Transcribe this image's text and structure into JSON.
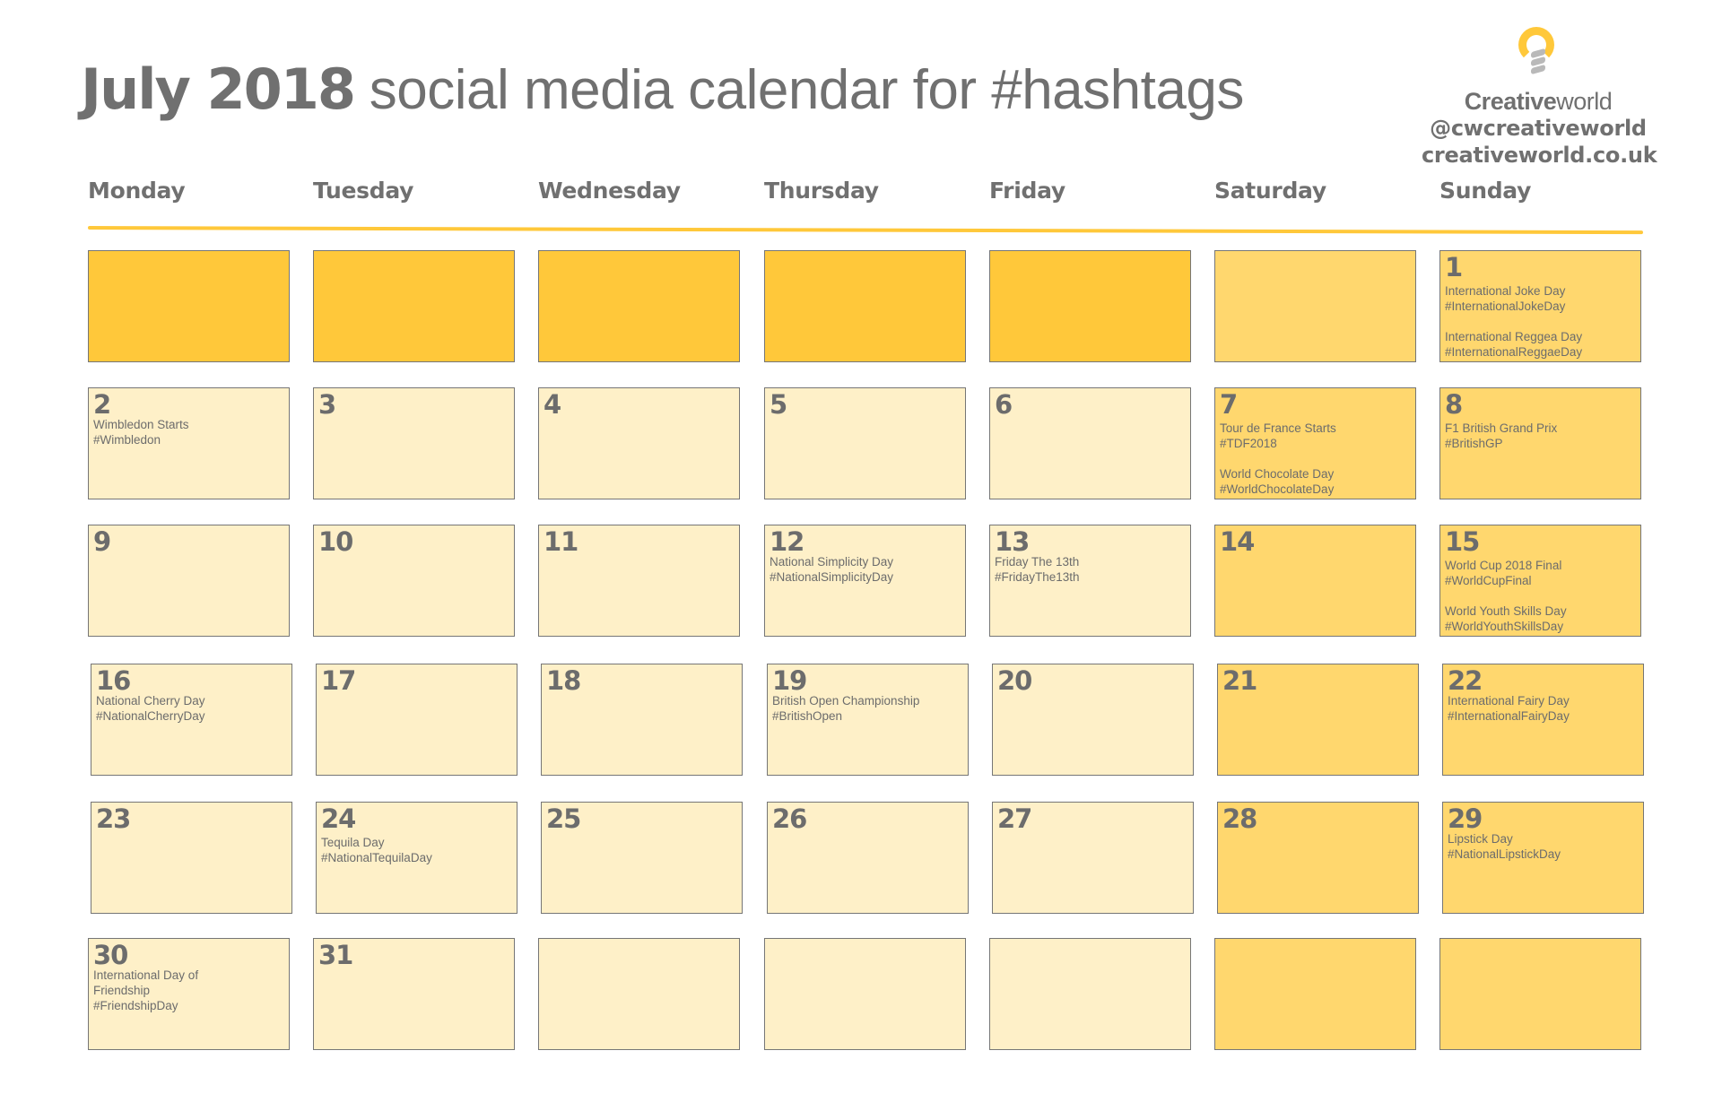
{
  "title": {
    "bold": "July 2018",
    "light": " social media calendar for #hashtags"
  },
  "brand": {
    "name_bold": "Creative",
    "name_light": "world",
    "handle": "@cwcreativeworld",
    "website": "creativeworld.co.uk",
    "logo_icon": "lightbulb-icon"
  },
  "colors": {
    "accent": "#FFC83A",
    "weekend": "#FFD76E",
    "weekday": "#FEF0C8",
    "text": "#707070",
    "border": "#767676"
  },
  "weekdays": [
    "Monday",
    "Tuesday",
    "Wednesday",
    "Thursday",
    "Friday",
    "Saturday",
    "Sunday"
  ],
  "weeks": [
    [
      {
        "day": "",
        "events": []
      },
      {
        "day": "",
        "events": []
      },
      {
        "day": "",
        "events": []
      },
      {
        "day": "",
        "events": []
      },
      {
        "day": "",
        "events": []
      },
      {
        "day": "",
        "events": []
      },
      {
        "day": "1",
        "events": [
          {
            "name": "International Joke Day",
            "hashtag": "#InternationalJokeDay"
          },
          {
            "name": "International Reggea Day",
            "hashtag": "#InternationalReggaeDay"
          }
        ]
      }
    ],
    [
      {
        "day": "2",
        "events": [
          {
            "name": "Wimbledon Starts",
            "hashtag": "#Wimbledon"
          }
        ]
      },
      {
        "day": "3",
        "events": []
      },
      {
        "day": "4",
        "events": []
      },
      {
        "day": "5",
        "events": []
      },
      {
        "day": "6",
        "events": []
      },
      {
        "day": "7",
        "events": [
          {
            "name": "Tour de France Starts",
            "hashtag": "#TDF2018"
          },
          {
            "name": "World Chocolate Day",
            "hashtag": "#WorldChocolateDay"
          }
        ]
      },
      {
        "day": "8",
        "events": [
          {
            "name": "F1 British Grand Prix",
            "hashtag": "#BritishGP"
          }
        ]
      }
    ],
    [
      {
        "day": "9",
        "events": []
      },
      {
        "day": "10",
        "events": []
      },
      {
        "day": "11",
        "events": []
      },
      {
        "day": "12",
        "events": [
          {
            "name": "National Simplicity Day",
            "hashtag": "#NationalSimplicityDay"
          }
        ]
      },
      {
        "day": "13",
        "events": [
          {
            "name": "Friday The 13th",
            "hashtag": "#FridayThe13th"
          }
        ]
      },
      {
        "day": "14",
        "events": []
      },
      {
        "day": "15",
        "events": [
          {
            "name": "World Cup 2018 Final",
            "hashtag": "#WorldCupFinal"
          },
          {
            "name": "World Youth Skills Day",
            "hashtag": "#WorldYouthSkillsDay"
          }
        ]
      }
    ],
    [
      {
        "day": "16",
        "events": [
          {
            "name": "National Cherry Day",
            "hashtag": "#NationalCherryDay"
          }
        ]
      },
      {
        "day": "17",
        "events": []
      },
      {
        "day": "18",
        "events": []
      },
      {
        "day": "19",
        "events": [
          {
            "name": "British Open Championship",
            "hashtag": "#BritishOpen"
          }
        ]
      },
      {
        "day": "20",
        "events": []
      },
      {
        "day": "21",
        "events": []
      },
      {
        "day": "22",
        "events": [
          {
            "name": "International Fairy Day",
            "hashtag": "#InternationalFairyDay"
          }
        ]
      }
    ],
    [
      {
        "day": "23",
        "events": []
      },
      {
        "day": "24",
        "events": [
          {
            "name": "Tequila Day",
            "hashtag": "#NationalTequilaDay"
          }
        ]
      },
      {
        "day": "25",
        "events": []
      },
      {
        "day": "26",
        "events": []
      },
      {
        "day": "27",
        "events": []
      },
      {
        "day": "28",
        "events": []
      },
      {
        "day": "29",
        "events": [
          {
            "name": "Lipstick Day",
            "hashtag": "#NationalLipstickDay"
          }
        ]
      }
    ],
    [
      {
        "day": "30",
        "events": [
          {
            "name": "International Day of Friendship",
            "hashtag": "#FriendshipDay"
          }
        ]
      },
      {
        "day": "31",
        "events": []
      },
      {
        "day": "",
        "events": []
      },
      {
        "day": "",
        "events": []
      },
      {
        "day": "",
        "events": []
      },
      {
        "day": "",
        "events": []
      },
      {
        "day": "",
        "events": []
      }
    ]
  ]
}
